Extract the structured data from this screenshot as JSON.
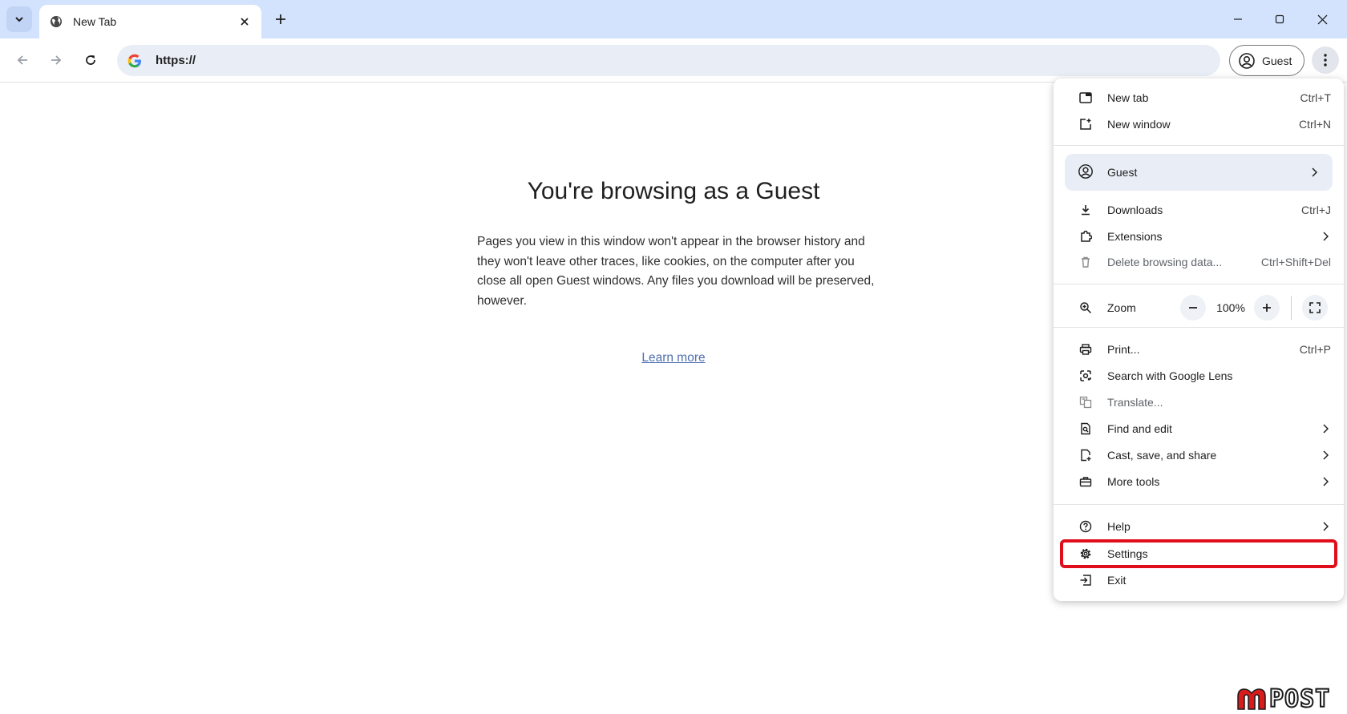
{
  "window": {
    "tab_title": "New Tab",
    "address": "https://",
    "profile_chip": "Guest"
  },
  "page": {
    "title": "You're browsing as a Guest",
    "description": "Pages you view in this window won't appear in the browser history and they won't leave other traces, like cookies, on the computer after you close all open Guest windows. Any files you download will be preserved, however.",
    "learn_more": "Learn more"
  },
  "menu": {
    "new_tab": {
      "label": "New tab",
      "shortcut": "Ctrl+T"
    },
    "new_window": {
      "label": "New window",
      "shortcut": "Ctrl+N"
    },
    "guest": {
      "label": "Guest"
    },
    "downloads": {
      "label": "Downloads",
      "shortcut": "Ctrl+J"
    },
    "extensions": {
      "label": "Extensions"
    },
    "delete_data": {
      "label": "Delete browsing data...",
      "shortcut": "Ctrl+Shift+Del"
    },
    "zoom": {
      "label": "Zoom",
      "value": "100%"
    },
    "print": {
      "label": "Print...",
      "shortcut": "Ctrl+P"
    },
    "lens": {
      "label": "Search with Google Lens"
    },
    "translate": {
      "label": "Translate..."
    },
    "find_edit": {
      "label": "Find and edit"
    },
    "cast_save": {
      "label": "Cast, save, and share"
    },
    "more_tools": {
      "label": "More tools"
    },
    "help": {
      "label": "Help"
    },
    "settings": {
      "label": "Settings"
    },
    "exit": {
      "label": "Exit"
    }
  },
  "watermark": {
    "text": "POST"
  },
  "colors": {
    "tabstrip": "#d3e3fd",
    "omnibox": "#e9eef6",
    "highlight": "#e00d1b",
    "link": "#4f6fb0",
    "watermark_red": "#d81b1b"
  }
}
